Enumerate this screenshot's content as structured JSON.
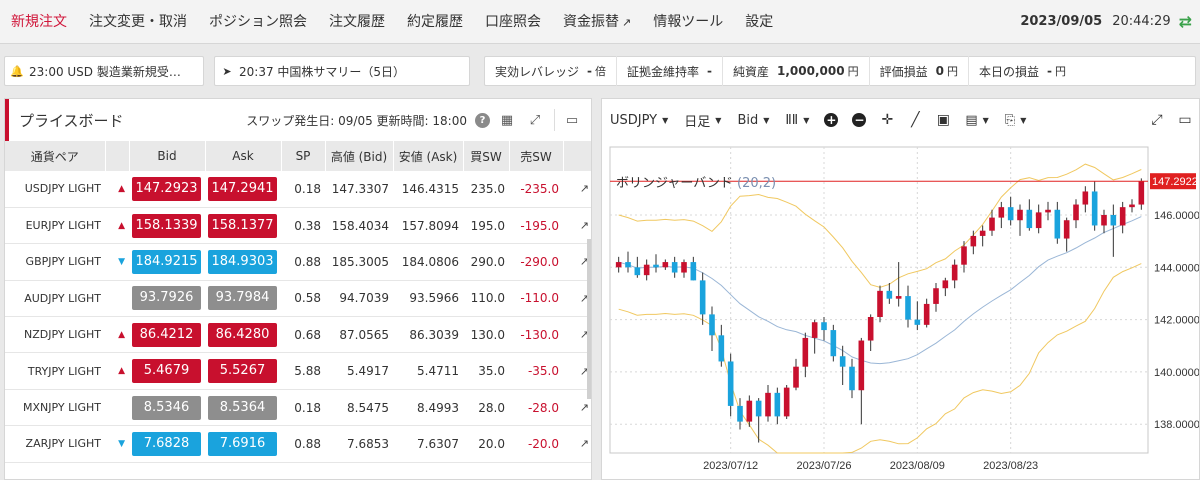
{
  "nav": {
    "items": [
      "新規注文",
      "注文変更・取消",
      "ポジション照会",
      "注文履歴",
      "約定履歴",
      "口座照会",
      "資金振替",
      "情報ツール",
      "設定"
    ],
    "date": "2023/09/05",
    "time": "20:44:29"
  },
  "news": [
    {
      "icon": "bell-icon",
      "text": "23:00 USD 製造業新規受…"
    },
    {
      "icon": "rocket-icon",
      "text": "20:37 中国株サマリー（5日）"
    }
  ],
  "stats": [
    {
      "label": "実効レバレッジ",
      "value": "-",
      "unit": "倍"
    },
    {
      "label": "証拠金維持率",
      "value": "-",
      "unit": ""
    },
    {
      "label": "純資産",
      "value": "1,000,000",
      "unit": "円"
    },
    {
      "label": "評価損益",
      "value": "0",
      "unit": "円"
    },
    {
      "label": "本日の損益",
      "value": "-",
      "unit": "円"
    }
  ],
  "board": {
    "title": "プライスボード",
    "swap_info": "スワップ発生日: 09/05 更新時間: 18:00",
    "columns": [
      "通貨ペア",
      "Bid",
      "Ask",
      "SP",
      "高値 (Bid)",
      "安値 (Ask)",
      "買SW",
      "売SW"
    ],
    "rows": [
      {
        "pair": "USDJPY LIGHT",
        "dir": "up",
        "bid": "147.2923",
        "ask": "147.2941",
        "sp": "0.18",
        "high": "147.3307",
        "low": "146.4315",
        "buy_sw": "235.0",
        "sell_sw": "-235.0"
      },
      {
        "pair": "EURJPY LIGHT",
        "dir": "up",
        "bid": "158.1339",
        "ask": "158.1377",
        "sp": "0.38",
        "high": "158.4034",
        "low": "157.8094",
        "buy_sw": "195.0",
        "sell_sw": "-195.0"
      },
      {
        "pair": "GBPJPY LIGHT",
        "dir": "down",
        "bid": "184.9215",
        "ask": "184.9303",
        "sp": "0.88",
        "high": "185.3005",
        "low": "184.0806",
        "buy_sw": "290.0",
        "sell_sw": "-290.0"
      },
      {
        "pair": "AUDJPY LIGHT",
        "dir": "flat",
        "bid": "93.7926",
        "ask": "93.7984",
        "sp": "0.58",
        "high": "94.7039",
        "low": "93.5966",
        "buy_sw": "110.0",
        "sell_sw": "-110.0"
      },
      {
        "pair": "NZDJPY LIGHT",
        "dir": "up",
        "bid": "86.4212",
        "ask": "86.4280",
        "sp": "0.68",
        "high": "87.0565",
        "low": "86.3039",
        "buy_sw": "130.0",
        "sell_sw": "-130.0"
      },
      {
        "pair": "TRYJPY LIGHT",
        "dir": "up",
        "bid": "5.4679",
        "ask": "5.5267",
        "sp": "5.88",
        "high": "5.4917",
        "low": "5.4711",
        "buy_sw": "35.0",
        "sell_sw": "-35.0"
      },
      {
        "pair": "MXNJPY LIGHT",
        "dir": "flat",
        "bid": "8.5346",
        "ask": "8.5364",
        "sp": "0.18",
        "high": "8.5475",
        "low": "8.4993",
        "buy_sw": "28.0",
        "sell_sw": "-28.0"
      },
      {
        "pair": "ZARJPY LIGHT",
        "dir": "down",
        "bid": "7.6828",
        "ask": "7.6916",
        "sp": "0.88",
        "high": "7.6853",
        "low": "7.6307",
        "buy_sw": "20.0",
        "sell_sw": "-20.0"
      }
    ]
  },
  "chart_toolbar": {
    "symbol": "USDJPY",
    "timeframe": "日足",
    "price_type": "Bid"
  },
  "chart_data": {
    "type": "candlestick",
    "indicator": "ボリンジャーバンド",
    "indicator_params": "(20,2)",
    "current_price": "147.2922",
    "ylim": [
      136.9,
      148.6
    ],
    "y_ticks": [
      "138.0000",
      "140.0000",
      "142.0000",
      "144.0000",
      "146.0000"
    ],
    "x_ticks": [
      {
        "label": "2023/07/12",
        "index": 12
      },
      {
        "label": "2023/07/26",
        "index": 22
      },
      {
        "label": "2023/08/09",
        "index": 32
      },
      {
        "label": "2023/08/23",
        "index": 42
      }
    ],
    "colors": {
      "up": "#c8102e",
      "down": "#1aa3dd",
      "band": "#f0c860",
      "mid": "#9ab6d6",
      "price_line": "#e02020"
    },
    "candles": [
      [
        144.0,
        144.4,
        143.8,
        144.2
      ],
      [
        144.2,
        144.6,
        143.8,
        144.0
      ],
      [
        144.0,
        144.4,
        143.6,
        143.7
      ],
      [
        143.7,
        144.3,
        143.5,
        144.1
      ],
      [
        144.1,
        144.5,
        143.8,
        144.0
      ],
      [
        144.0,
        144.3,
        143.9,
        144.2
      ],
      [
        144.2,
        144.4,
        143.6,
        143.8
      ],
      [
        143.8,
        144.3,
        143.6,
        144.2
      ],
      [
        144.2,
        144.4,
        143.5,
        143.5
      ],
      [
        143.5,
        143.8,
        141.8,
        142.2
      ],
      [
        142.2,
        142.5,
        140.8,
        141.4
      ],
      [
        141.4,
        141.8,
        140.2,
        140.4
      ],
      [
        140.4,
        140.7,
        138.3,
        138.7
      ],
      [
        138.7,
        139.0,
        137.8,
        138.1
      ],
      [
        138.1,
        139.1,
        137.9,
        138.9
      ],
      [
        138.9,
        139.0,
        137.3,
        138.3
      ],
      [
        138.3,
        139.5,
        138.1,
        139.2
      ],
      [
        139.2,
        139.4,
        138.0,
        138.3
      ],
      [
        138.3,
        139.5,
        138.2,
        139.4
      ],
      [
        139.4,
        140.5,
        139.3,
        140.2
      ],
      [
        140.2,
        141.5,
        139.8,
        141.3
      ],
      [
        141.3,
        142.0,
        140.7,
        141.9
      ],
      [
        141.9,
        142.1,
        141.2,
        141.6
      ],
      [
        141.6,
        141.8,
        140.4,
        140.6
      ],
      [
        140.6,
        141.0,
        139.5,
        140.2
      ],
      [
        140.2,
        140.5,
        139.0,
        139.3
      ],
      [
        139.3,
        141.3,
        138.0,
        141.2
      ],
      [
        141.2,
        142.2,
        140.8,
        142.1
      ],
      [
        142.1,
        143.3,
        141.9,
        143.1
      ],
      [
        143.1,
        143.4,
        142.6,
        142.8
      ],
      [
        142.8,
        144.2,
        142.5,
        142.9
      ],
      [
        142.9,
        143.3,
        141.7,
        142.0
      ],
      [
        142.0,
        142.7,
        141.6,
        141.8
      ],
      [
        141.8,
        142.8,
        141.7,
        142.6
      ],
      [
        142.6,
        143.4,
        142.3,
        143.2
      ],
      [
        143.2,
        143.6,
        142.9,
        143.5
      ],
      [
        143.5,
        144.3,
        143.2,
        144.1
      ],
      [
        144.1,
        145.0,
        143.8,
        144.8
      ],
      [
        144.8,
        145.4,
        144.5,
        145.2
      ],
      [
        145.2,
        145.6,
        144.8,
        145.4
      ],
      [
        145.4,
        146.2,
        145.2,
        145.9
      ],
      [
        145.9,
        146.5,
        145.5,
        146.3
      ],
      [
        146.3,
        146.7,
        145.6,
        145.8
      ],
      [
        145.8,
        146.4,
        145.2,
        146.2
      ],
      [
        146.2,
        146.6,
        145.4,
        145.5
      ],
      [
        145.5,
        146.4,
        145.3,
        146.1
      ],
      [
        146.1,
        146.5,
        145.8,
        146.2
      ],
      [
        146.2,
        146.5,
        144.9,
        145.1
      ],
      [
        145.1,
        145.9,
        144.6,
        145.8
      ],
      [
        145.8,
        146.6,
        145.5,
        146.4
      ],
      [
        146.4,
        147.1,
        146.1,
        146.9
      ],
      [
        146.9,
        147.3,
        145.4,
        145.6
      ],
      [
        145.6,
        146.2,
        145.3,
        146.0
      ],
      [
        146.0,
        146.4,
        144.4,
        145.6
      ],
      [
        145.6,
        146.5,
        145.3,
        146.3
      ],
      [
        146.3,
        146.6,
        146.1,
        146.4
      ],
      [
        146.4,
        147.4,
        146.2,
        147.3
      ]
    ]
  }
}
